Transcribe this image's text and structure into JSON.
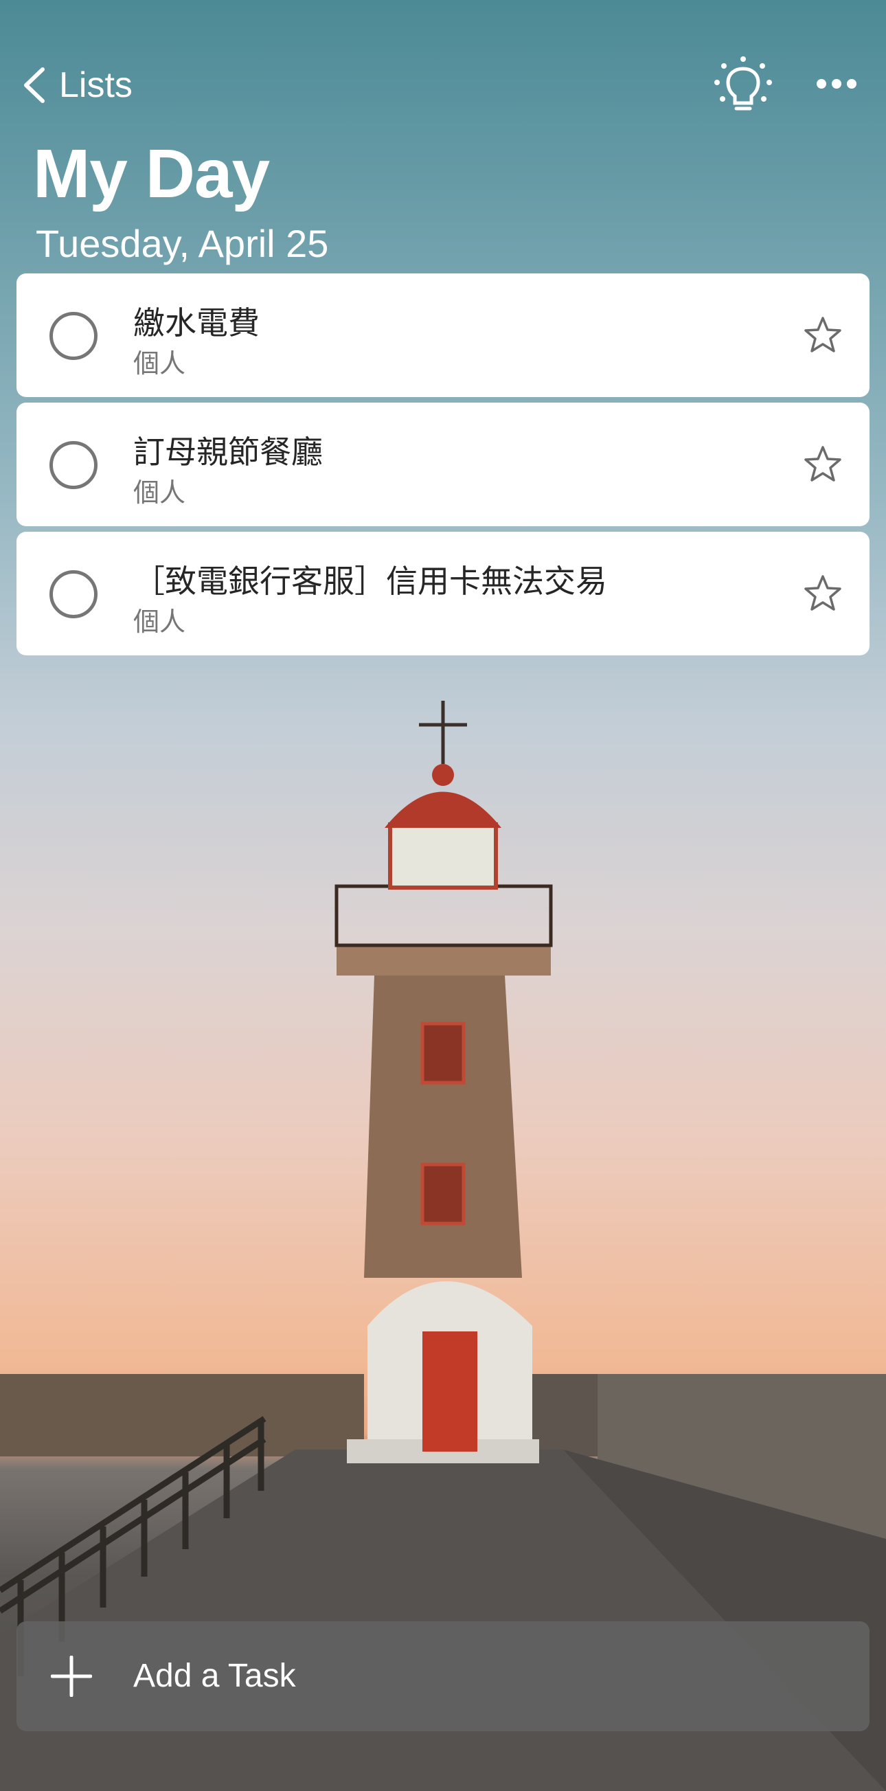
{
  "header": {
    "back_label": "Lists",
    "title": "My Day",
    "date": "Tuesday, April 25",
    "suggestions_icon": "lightbulb-icon",
    "more_icon": "more-icon"
  },
  "tasks": [
    {
      "title": "繳水電費",
      "list": "個人",
      "completed": false,
      "important": false
    },
    {
      "title": "訂母親節餐廳",
      "list": "個人",
      "completed": false,
      "important": false
    },
    {
      "title": "［致電銀行客服］信用卡無法交易",
      "list": "個人",
      "completed": false,
      "important": false
    }
  ],
  "add_task": {
    "label": "Add a Task",
    "icon": "plus-icon"
  },
  "background": {
    "subject": "lighthouse-on-pier-at-sunset"
  },
  "colors": {
    "card": "#ffffff",
    "text": "#262626",
    "secondary": "#767676",
    "accent_red": "#b23a2a"
  }
}
